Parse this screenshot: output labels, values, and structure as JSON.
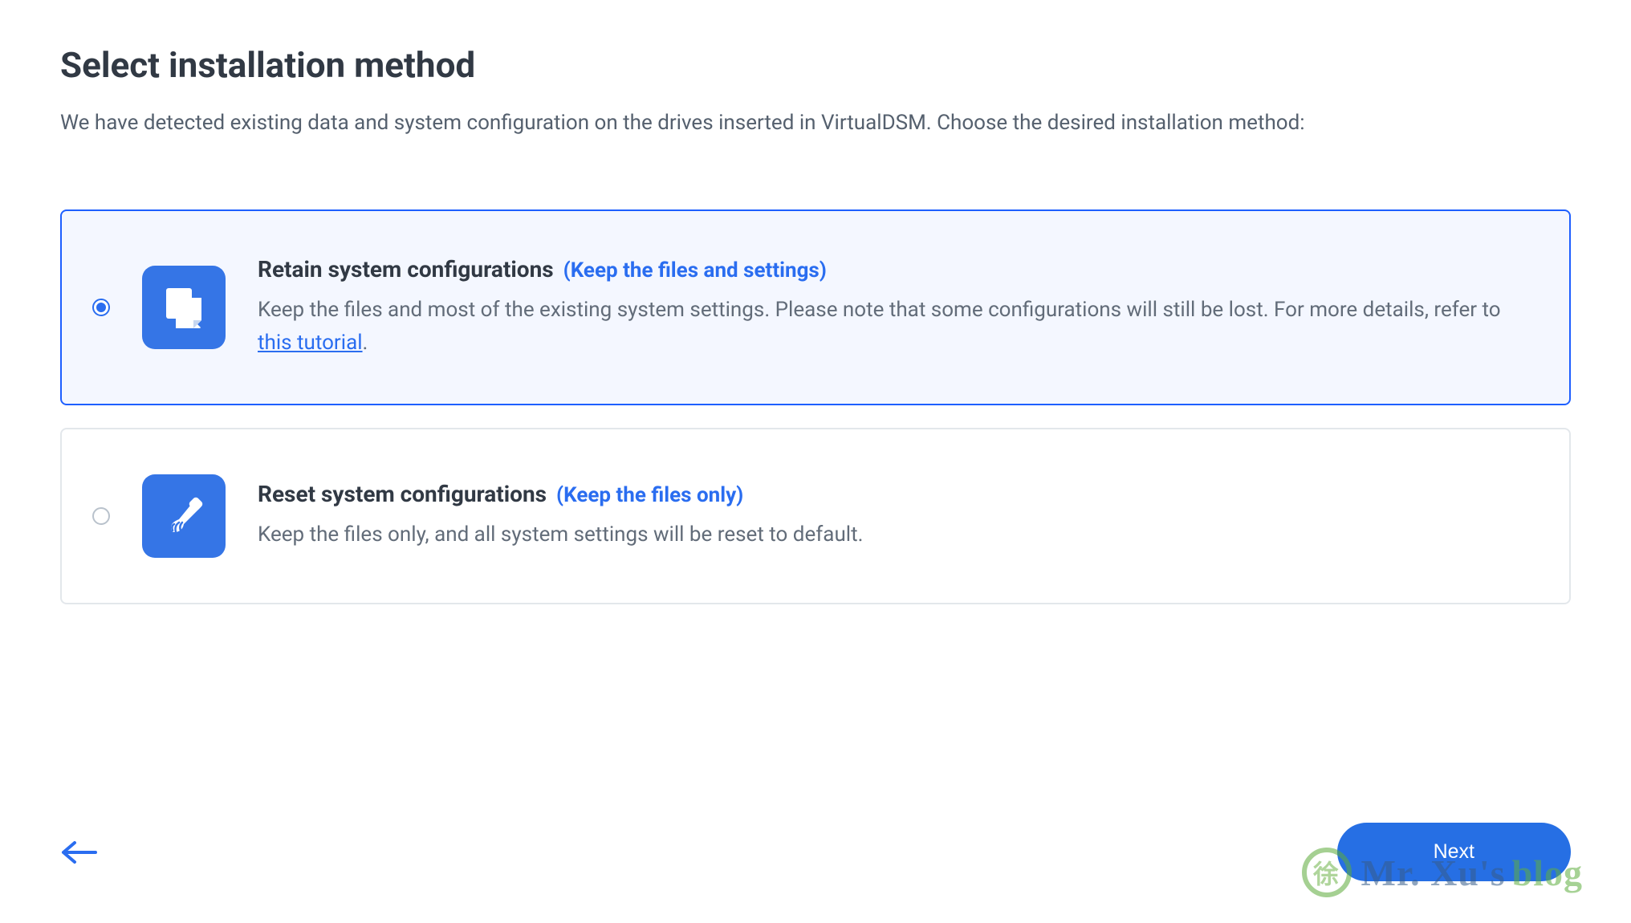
{
  "page": {
    "title": "Select installation method",
    "subtitle": "We have detected existing data and system configuration on the drives inserted in VirtualDSM. Choose the desired installation method:"
  },
  "options": {
    "retain": {
      "title": "Retain system configurations",
      "hint": "(Keep the files and settings)",
      "desc_pre": "Keep the files and most of the existing system settings. Please note that some configurations will still be lost. For more details, refer to ",
      "link_text": "this tutorial",
      "desc_post": ".",
      "selected": true
    },
    "reset": {
      "title": "Reset system configurations",
      "hint": "(Keep the files only)",
      "desc": "Keep the files only, and all system settings will be reset to default.",
      "selected": false
    }
  },
  "buttons": {
    "next": "Next"
  },
  "watermark": {
    "circle": "徐",
    "part1": "Mr. Xu's",
    "part2": "blog"
  }
}
